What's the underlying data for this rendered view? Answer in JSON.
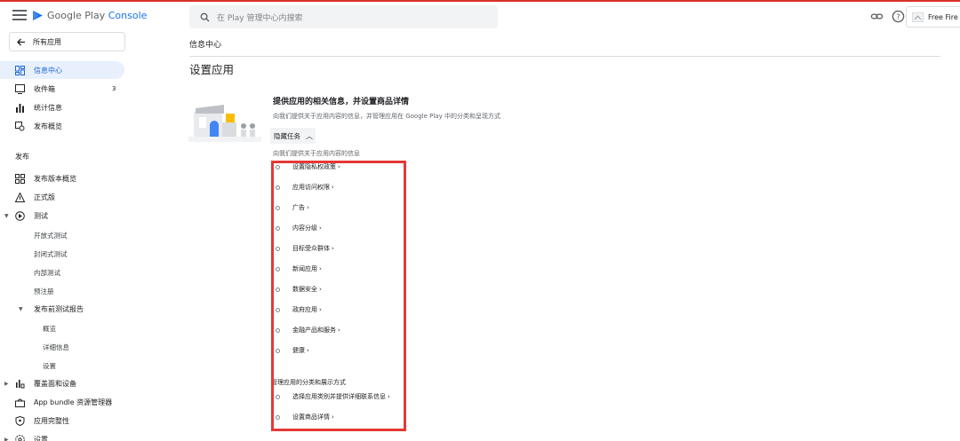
{
  "header": {
    "brand_plain": "Google Play",
    "brand_accent": "Console",
    "search_placeholder": "在 Play 管理中心内搜索",
    "app_name": "Free Fire"
  },
  "sidebar": {
    "all_apps": "所有应用",
    "items": [
      {
        "label": "信息中心",
        "icon": "dashboard-icon",
        "active": true
      },
      {
        "label": "收件箱",
        "icon": "inbox-icon",
        "badge": "3"
      },
      {
        "label": "统计信息",
        "icon": "stats-icon"
      },
      {
        "label": "发布概览",
        "icon": "publishing-overview-icon"
      }
    ],
    "release_header": "发布",
    "release_items": [
      {
        "label": "发布版本概览",
        "icon": "releases-overview-icon"
      },
      {
        "label": "正式版",
        "icon": "production-icon"
      },
      {
        "label": "测试",
        "icon": "testing-icon"
      }
    ],
    "testing_subitems": [
      "开放式测试",
      "封闭式测试",
      "内部测试",
      "预注册"
    ],
    "prelaunch_label": "发布前测试报告",
    "prelaunch_subitems": [
      "概览",
      "详细信息",
      "设置"
    ],
    "bottom_items": [
      {
        "label": "覆盖面和设备",
        "icon": "reach-devices-icon"
      },
      {
        "label": "App bundle 资源管理器",
        "icon": "app-bundle-icon"
      },
      {
        "label": "应用完整性",
        "icon": "app-integrity-icon"
      },
      {
        "label": "设置",
        "icon": "setup-icon"
      }
    ]
  },
  "main": {
    "breadcrumb": "信息中心",
    "page_title": "设置应用",
    "card_title": "提供应用的相关信息，并设置商品详情",
    "card_desc": "向我们提供关于应用内容的信息，并管理应用在 Google Play 中的分类和呈现方式",
    "hide_tasks": "隐藏任务",
    "tasks_header": "向我们提供关于应用内容的信息",
    "tasks": [
      "设置隐私权政策",
      "应用访问权限",
      "广告",
      "内容分级",
      "目标受众群体",
      "新闻应用",
      "数据安全",
      "政府应用",
      "金融产品和服务",
      "健康"
    ],
    "group2_header": "管理应用的分类和展示方式",
    "group2_tasks": [
      "选择应用类别并提供详细联系信息",
      "设置商品详情"
    ]
  },
  "colors": {
    "accent": "#1a73e8",
    "active_bg": "#e8f0fe",
    "highlight_box": "#e53935",
    "top_line": "#d93025"
  }
}
